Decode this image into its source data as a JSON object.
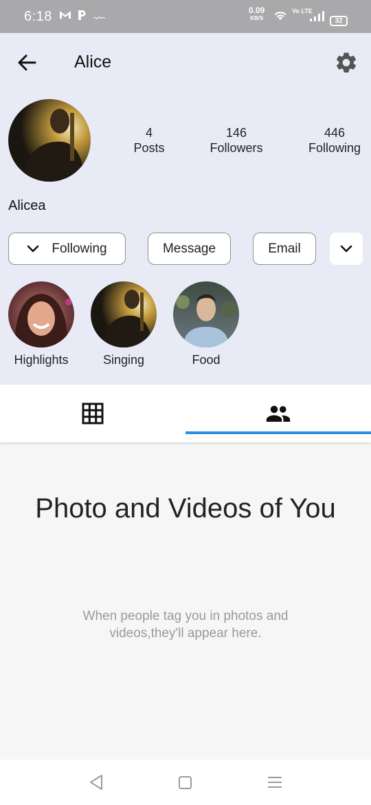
{
  "status_bar": {
    "time": "6:18",
    "speed_value": "0.09",
    "speed_unit": "KB/S",
    "network_label": "Vo LTE",
    "battery": "32",
    "icons": [
      "gmail-icon",
      "p-app-icon",
      "notification-icon",
      "wifi-icon",
      "signal-icon",
      "battery-icon"
    ]
  },
  "header": {
    "title": "Alice",
    "back_icon": "arrow-back-icon",
    "settings_icon": "gear-icon"
  },
  "profile": {
    "username": "Alicea",
    "stats": [
      {
        "value": "4",
        "label": "Posts"
      },
      {
        "value": "146",
        "label": "Followers"
      },
      {
        "value": "446",
        "label": "Following"
      }
    ]
  },
  "actions": {
    "following_label": "Following",
    "message_label": "Message",
    "email_label": "Email",
    "more_icon": "chevron-down-icon"
  },
  "highlights": [
    {
      "label": "Highlights"
    },
    {
      "label": "Singing"
    },
    {
      "label": "Food"
    }
  ],
  "tabs": [
    {
      "icon": "grid-icon",
      "selected": false
    },
    {
      "icon": "tagged-people-icon",
      "selected": true
    }
  ],
  "empty_state": {
    "title": "Photo and Videos of You",
    "subtitle": "When people tag you in photos and videos,they'll appear here."
  },
  "nav_bar": {
    "icons": [
      "back-triangle-icon",
      "home-square-icon",
      "recents-menu-icon"
    ]
  },
  "colors": {
    "header_bg": "#e8ebf6",
    "tab_indicator": "#2f8fe0",
    "status_bar": "#a9a9ab"
  }
}
